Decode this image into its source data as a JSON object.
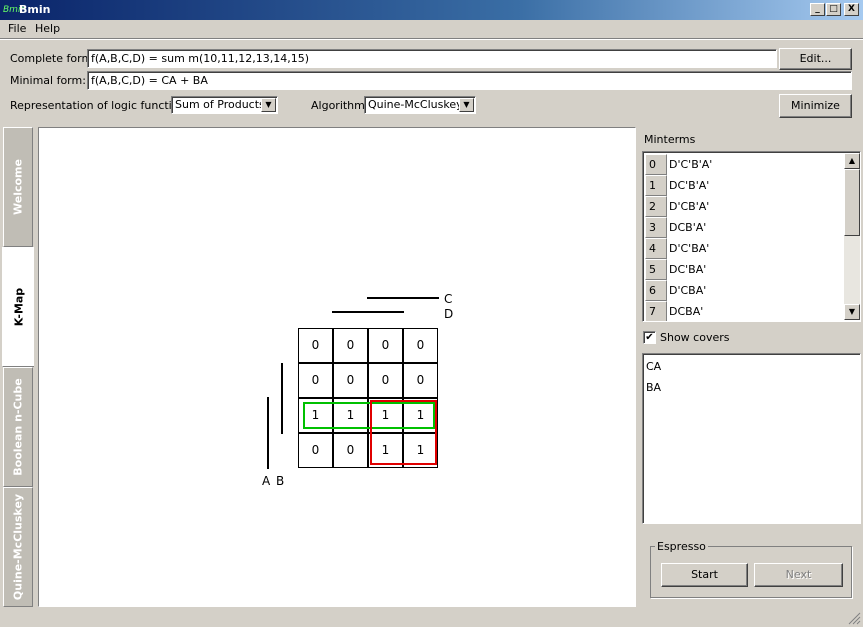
{
  "window": {
    "title": "Bmin",
    "logo_text": "Bmin"
  },
  "title_buttons": {
    "minimize": "_",
    "maximize": "□",
    "close": "X"
  },
  "menu": {
    "items": [
      "File",
      "Help"
    ]
  },
  "form": {
    "complete_label": "Complete form:",
    "complete_value": "f(A,B,C,D) = sum m(10,11,12,13,14,15)",
    "edit_button": "Edit...",
    "minimal_label": "Minimal form:",
    "minimal_value": "f(A,B,C,D) = CA + BA",
    "representation_label": "Representation of logic function:",
    "representation_value": "Sum of Products",
    "algorithm_label": "Algorithm:",
    "algorithm_value": "Quine-McCluskey",
    "minimize_button": "Minimize"
  },
  "tabs": [
    "Welcome",
    "K-Map",
    "Boolean n-Cube",
    "Quine-McCluskey"
  ],
  "active_tab": "K-Map",
  "kmap": {
    "rows": [
      [
        "0",
        "0",
        "0",
        "0"
      ],
      [
        "0",
        "0",
        "0",
        "0"
      ],
      [
        "1",
        "1",
        "1",
        "1"
      ],
      [
        "0",
        "0",
        "1",
        "1"
      ]
    ],
    "labels": {
      "c": "C",
      "d": "D",
      "a": "A",
      "b": "B"
    },
    "cover_colors": {
      "CA": "#00c000",
      "BA": "#e00000"
    }
  },
  "minterms": {
    "header": "Minterms",
    "items": [
      {
        "index": "0",
        "term": "D'C'B'A'"
      },
      {
        "index": "1",
        "term": "DC'B'A'"
      },
      {
        "index": "2",
        "term": "D'CB'A'"
      },
      {
        "index": "3",
        "term": "DCB'A'"
      },
      {
        "index": "4",
        "term": "D'C'BA'"
      },
      {
        "index": "5",
        "term": "DC'BA'"
      },
      {
        "index": "6",
        "term": "D'CBA'"
      },
      {
        "index": "7",
        "term": "DCBA'"
      }
    ]
  },
  "show_covers": {
    "label": "Show covers",
    "checked": "✔"
  },
  "covers": [
    "CA",
    "BA"
  ],
  "espresso": {
    "title": "Espresso",
    "start": "Start",
    "next": "Next"
  },
  "icons": {
    "scroll_up": "▲",
    "scroll_down": "▼",
    "combo_arrow": "▼"
  }
}
